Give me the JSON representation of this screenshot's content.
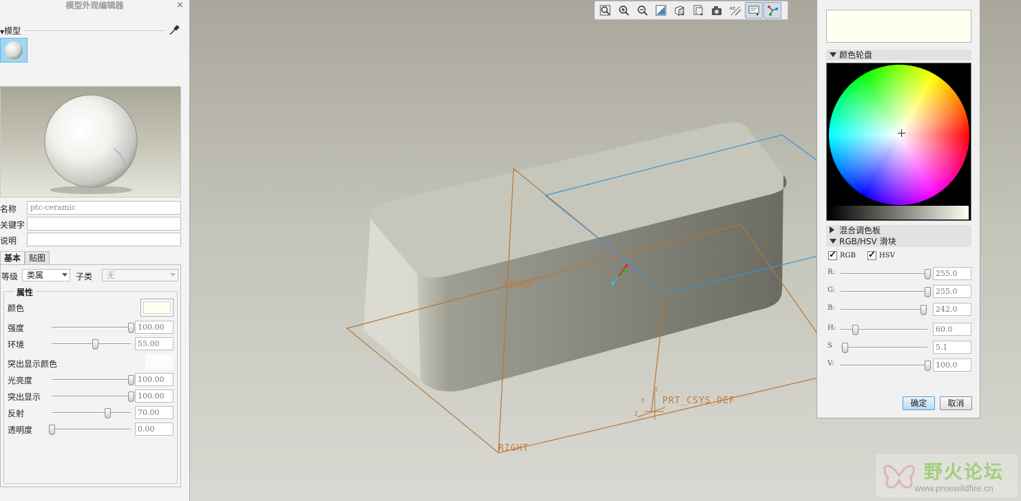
{
  "left_panel": {
    "title": "模型外观编辑器",
    "close": "×",
    "model_section": "模型",
    "fields": {
      "name_label": "名称",
      "name_value": "ptc-ceramic",
      "keyword_label": "关键字",
      "keyword_value": "",
      "desc_label": "说明",
      "desc_value": ""
    },
    "tabs": [
      "基本",
      "贴图"
    ],
    "grade_label": "等级",
    "grade_value": "类属",
    "subclass_label": "子类",
    "subclass_value": "无",
    "properties_title": "属性",
    "color_label": "颜色",
    "color_hex": "#fffff2",
    "highlight_color_label": "突出显示颜色",
    "properties": [
      {
        "label": "强度",
        "value": "100.00",
        "fraction": 1.0
      },
      {
        "label": "环境",
        "value": "55.00",
        "fraction": 0.55
      },
      {
        "label": "光亮度",
        "value": "100.00",
        "fraction": 1.0
      },
      {
        "label": "突出显示",
        "value": "100.00",
        "fraction": 1.0
      },
      {
        "label": "反射",
        "value": "70.00",
        "fraction": 0.7
      },
      {
        "label": "透明度",
        "value": "0.00",
        "fraction": 0.0
      }
    ]
  },
  "viewport": {
    "labels": {
      "front": "FRONT",
      "right": "RIGHT",
      "csys": "PRT_CSYS_DEF",
      "x": "X",
      "y": "Y",
      "z": "Z"
    }
  },
  "toolbar": {
    "icons": [
      "refit-icon",
      "zoom-in-icon",
      "zoom-out-icon",
      "repaint-icon",
      "orientation-icon",
      "saved-views-icon",
      "layers-icon",
      "display-style-icon",
      "datum-display-icon",
      "annotation-display-icon"
    ]
  },
  "color_panel": {
    "current_color": "#fffff2",
    "wheel_section": "颜色轮盘",
    "mix_section": "混合调色板",
    "slider_section": "RGB/HSV 滑块",
    "rgb_label": "RGB",
    "hsv_label": "HSV",
    "sliders": [
      {
        "label": "R:",
        "value": "255.0",
        "fraction": 1.0
      },
      {
        "label": "G:",
        "value": "255.0",
        "fraction": 1.0
      },
      {
        "label": "B:",
        "value": "242.0",
        "fraction": 0.949
      },
      {
        "label": "H:",
        "value": "60.0",
        "fraction": 0.167
      },
      {
        "label": "S",
        "value": "5.1",
        "fraction": 0.051
      },
      {
        "label": "V:",
        "value": "100.0",
        "fraction": 1.0
      }
    ],
    "ok_button": "确定",
    "cancel_button": "取消"
  },
  "watermark": {
    "text": "野火论坛",
    "url": "www.proewildfire.cn"
  }
}
